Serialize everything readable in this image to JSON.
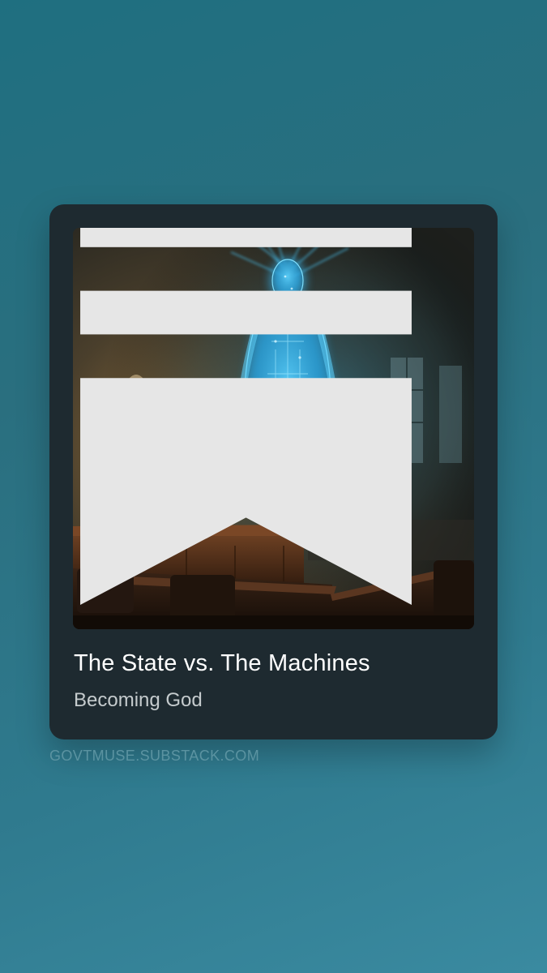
{
  "post": {
    "title": "The State vs. The Machines",
    "subtitle": "Becoming God"
  },
  "footer": {
    "domain": "GOVTMUSE.SUBSTACK.COM"
  },
  "icons": {
    "cover_badge": "substack-logo-icon"
  },
  "colors": {
    "background": "#2a6f7f",
    "card": "#1e2a30",
    "title": "#ffffff",
    "subtitle": "#c5cbcd",
    "domain": "#5b93a1",
    "glow": "#35b8f0"
  }
}
